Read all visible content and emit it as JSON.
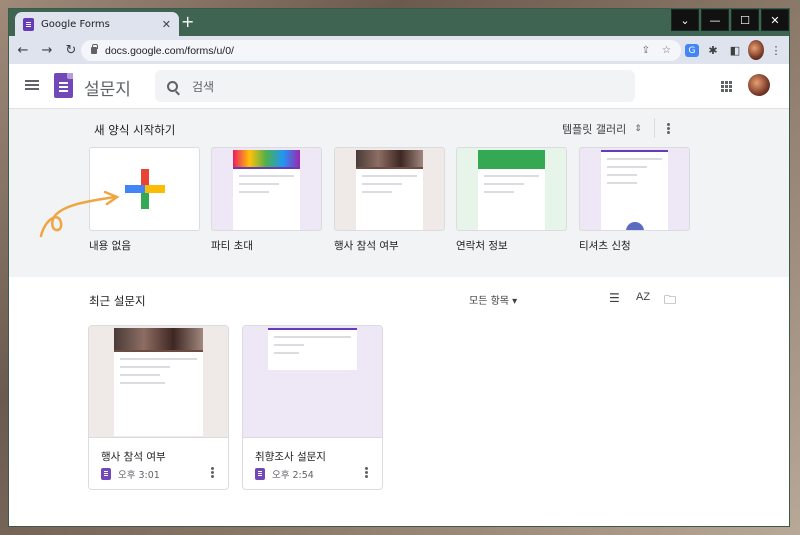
{
  "browser": {
    "tab_title": "Google Forms",
    "close_glyph": "✕",
    "new_tab_glyph": "+",
    "url": "docs.google.com/forms/u/0/",
    "window_controls": {
      "chevron": "⌄",
      "minimize": "—",
      "maximize": "☐",
      "close": "✕"
    }
  },
  "app": {
    "title": "설문지",
    "search_placeholder": "검색"
  },
  "gallery": {
    "heading": "새 양식 시작하기",
    "gallery_link": "템플릿 갤러리",
    "templates": [
      {
        "label": "내용 없음"
      },
      {
        "label": "파티 초대"
      },
      {
        "label": "행사 참석 여부"
      },
      {
        "label": "연락처 정보"
      },
      {
        "label": "티셔츠 신청"
      }
    ]
  },
  "recent": {
    "heading": "최근 설문지",
    "owner_filter": "모든 항목 ▾",
    "docs": [
      {
        "name": "행사 참석 여부",
        "time": "오후 3:01"
      },
      {
        "name": "취향조사 설문지",
        "time": "오후 2:54"
      }
    ]
  },
  "colors": {
    "forms_purple": "#673ab7",
    "tab_strip": "#3f6552"
  }
}
